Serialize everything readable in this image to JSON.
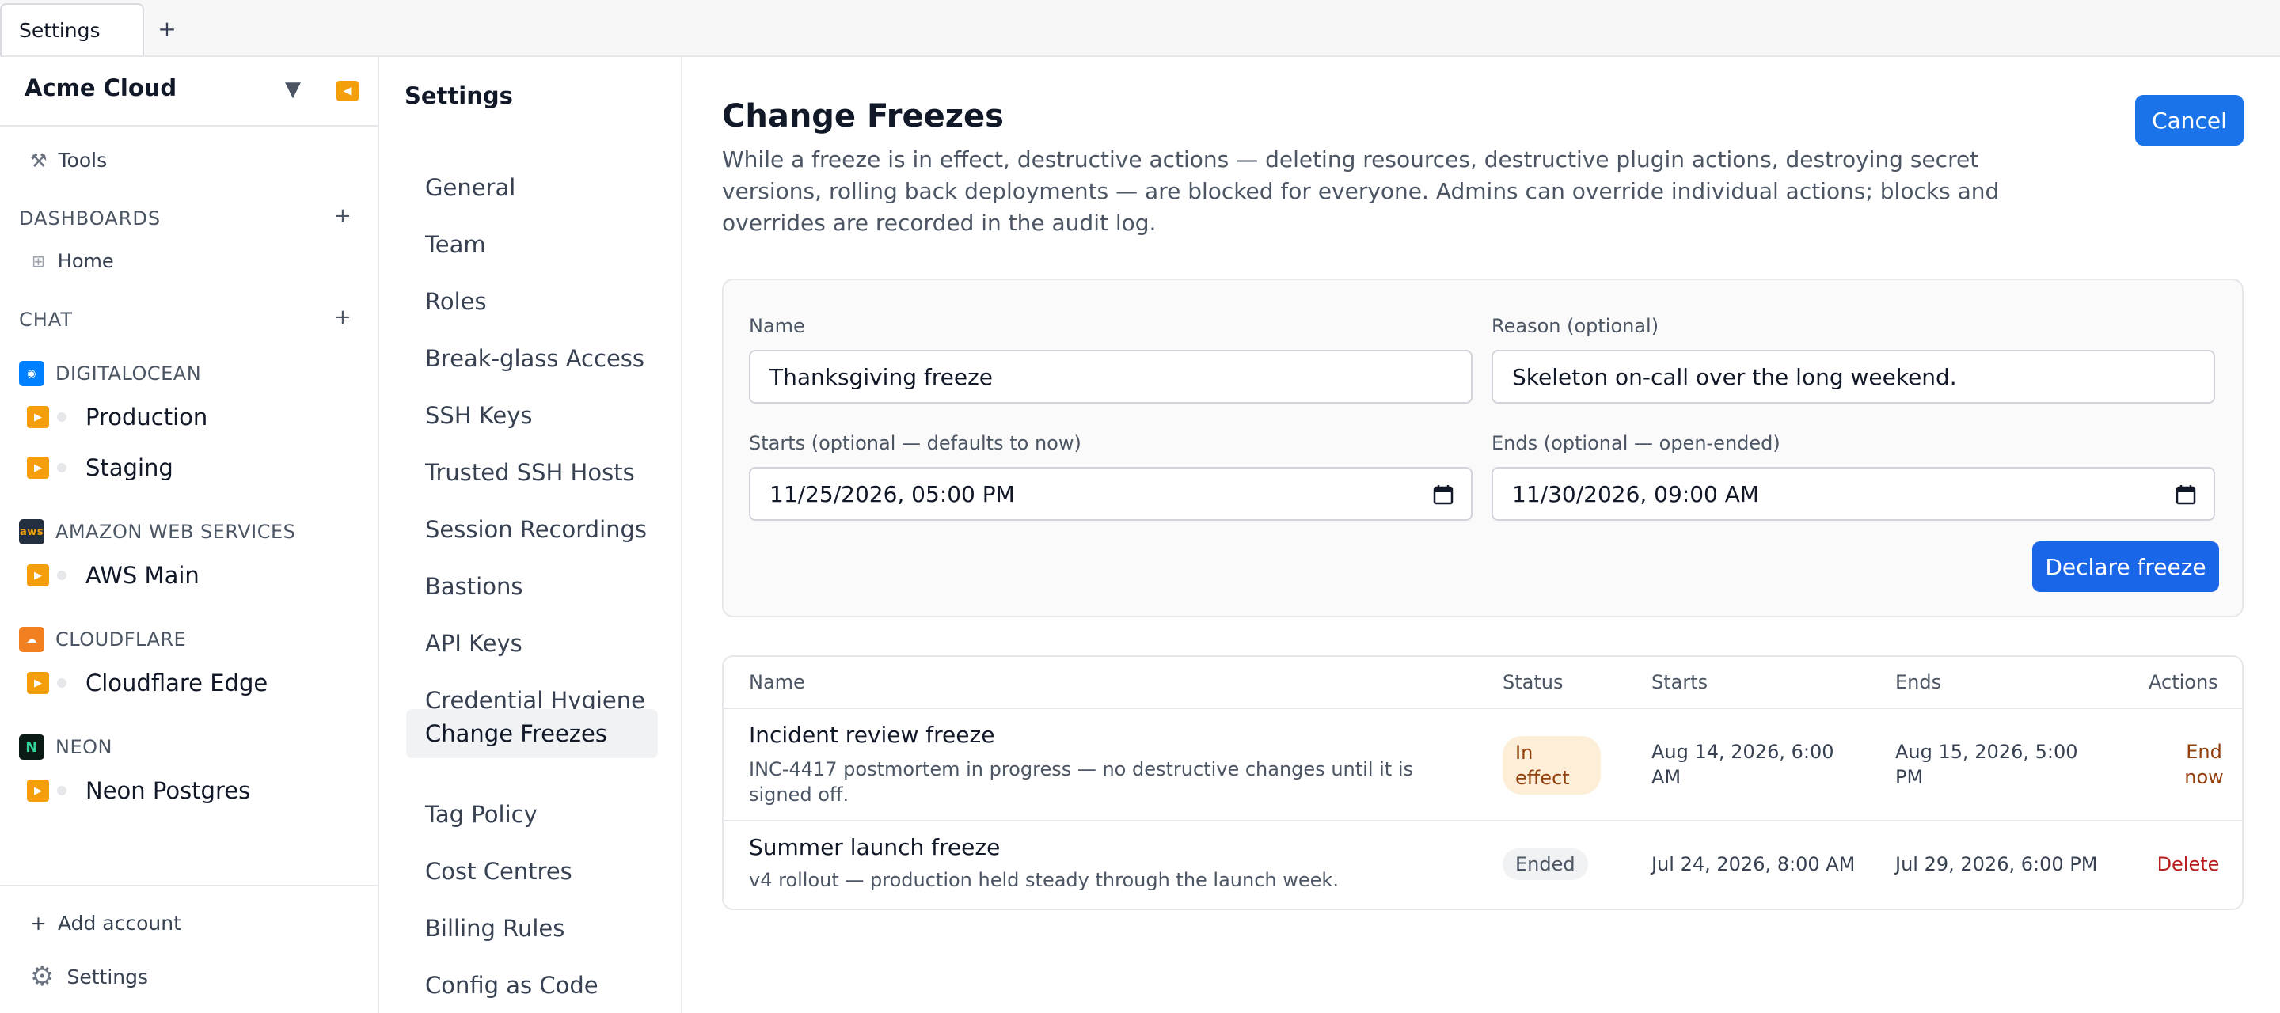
{
  "tabs": {
    "active_label": "Settings",
    "new_tab": "+"
  },
  "sidebar": {
    "org_name": "Acme Cloud",
    "tools_label": "Tools",
    "dashboards_heading": "DASHBOARDS",
    "home_label": "Home",
    "chat_heading": "CHAT",
    "providers": [
      {
        "name": "DIGITALOCEAN",
        "connections": [
          "Production",
          "Staging"
        ]
      },
      {
        "name": "AMAZON WEB SERVICES",
        "logo_text": "aws",
        "connections": [
          "AWS Main"
        ]
      },
      {
        "name": "CLOUDFLARE",
        "connections": [
          "Cloudflare Edge"
        ]
      },
      {
        "name": "NEON",
        "connections": [
          "Neon Postgres"
        ]
      }
    ],
    "add_account_label": "Add account",
    "settings_label": "Settings"
  },
  "settings_nav": {
    "title": "Settings",
    "items": [
      "General",
      "Team",
      "Roles",
      "Break-glass Access",
      "SSH Keys",
      "Trusted SSH Hosts",
      "Session Recordings",
      "Bastions",
      "API Keys",
      "Credential Hygiene",
      "Change Freezes",
      "Tag Policy",
      "Cost Centres",
      "Billing Rules",
      "Config as Code"
    ],
    "active": "Change Freezes"
  },
  "main": {
    "title": "Change Freezes",
    "description": "While a freeze is in effect, destructive actions — deleting resources, destructive plugin actions, destroying secret versions, rolling back deployments — are blocked for everyone. Admins can override individual actions; blocks and overrides are recorded in the audit log.",
    "cancel_label": "Cancel"
  },
  "form": {
    "name_label": "Name",
    "name_value": "Thanksgiving freeze",
    "reason_label": "Reason (optional)",
    "reason_value": "Skeleton on-call over the long weekend.",
    "starts_label": "Starts (optional — defaults to now)",
    "starts_value": "11/25/2026, 05:00 PM",
    "ends_label": "Ends (optional — open-ended)",
    "ends_value": "11/30/2026, 09:00 AM",
    "submit_label": "Declare freeze"
  },
  "table": {
    "headers": [
      "Name",
      "Status",
      "Starts",
      "Ends",
      "Actions"
    ],
    "rows": [
      {
        "name": "Incident review freeze",
        "description": "INC-4417 postmortem in progress — no destructive changes until it is signed off.",
        "status": "In effect",
        "starts": "Aug 14, 2026, 6:00 AM",
        "ends": "Aug 15, 2026, 5:00 PM",
        "action": "End now"
      },
      {
        "name": "Summer launch freeze",
        "description": "v4 rollout — production held steady through the launch week.",
        "status": "Ended",
        "starts": "Jul 24, 2026, 8:00 AM",
        "ends": "Jul 29, 2026, 6:00 PM",
        "action": "Delete"
      }
    ]
  },
  "colors": {
    "accent": "#1a73e8",
    "warning_bg": "#fdeed8",
    "danger": "#b91c1c",
    "provider_orange": "#f59e0b"
  },
  "icons": [
    "wrench-icon",
    "grid-icon",
    "plus-icon",
    "chevron-down-icon",
    "collapse-icon",
    "play-icon",
    "gear-icon",
    "calendar-icon"
  ]
}
